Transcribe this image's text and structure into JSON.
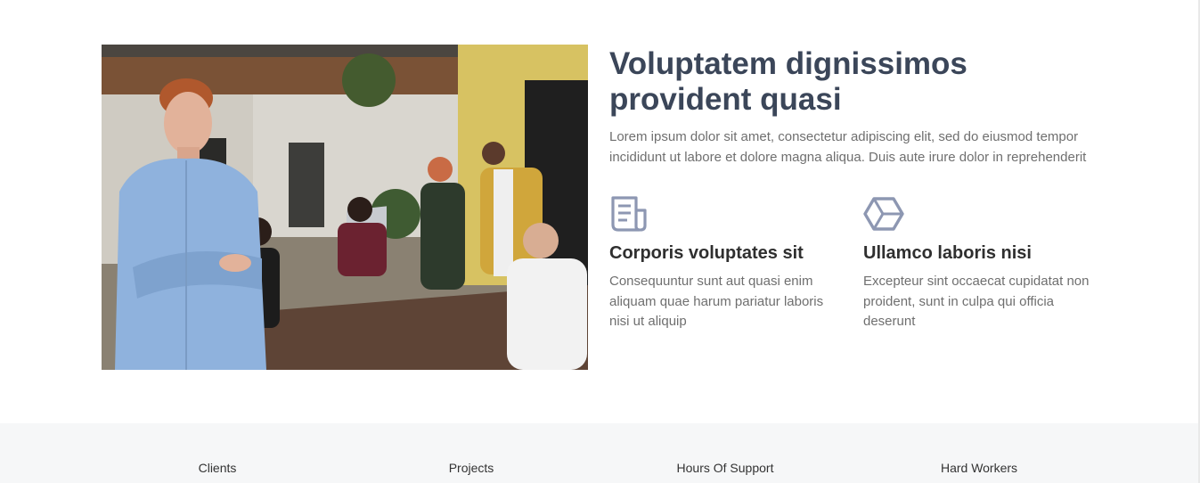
{
  "about": {
    "title": "Voluptatem dignissimos provident quasi",
    "lead": "Lorem ipsum dolor sit amet, consectetur adipiscing elit, sed do eiusmod tempor incididunt ut labore et dolore magna aliqua. Duis aute irure dolor in reprehenderit",
    "image_alt": "Team working at a shared table in an office",
    "features": [
      {
        "icon": "receipt-icon",
        "title": "Corporis voluptates sit",
        "text": "Consequuntur sunt aut quasi enim aliquam quae harum pariatur laboris nisi ut aliquip"
      },
      {
        "icon": "cube-icon",
        "title": "Ullamco laboris nisi",
        "text": "Excepteur sint occaecat cupidatat non proident, sunt in culpa qui officia deserunt"
      }
    ]
  },
  "counts": {
    "items": [
      {
        "label": "Clients"
      },
      {
        "label": "Projects"
      },
      {
        "label": "Hours Of Support"
      },
      {
        "label": "Hard Workers"
      }
    ]
  },
  "colors": {
    "heading": "#3b4659",
    "body_text": "#6f6f6f",
    "icon": "#8d97b2",
    "counts_bg": "#f6f7f8",
    "accent": "#9ccc2e"
  }
}
